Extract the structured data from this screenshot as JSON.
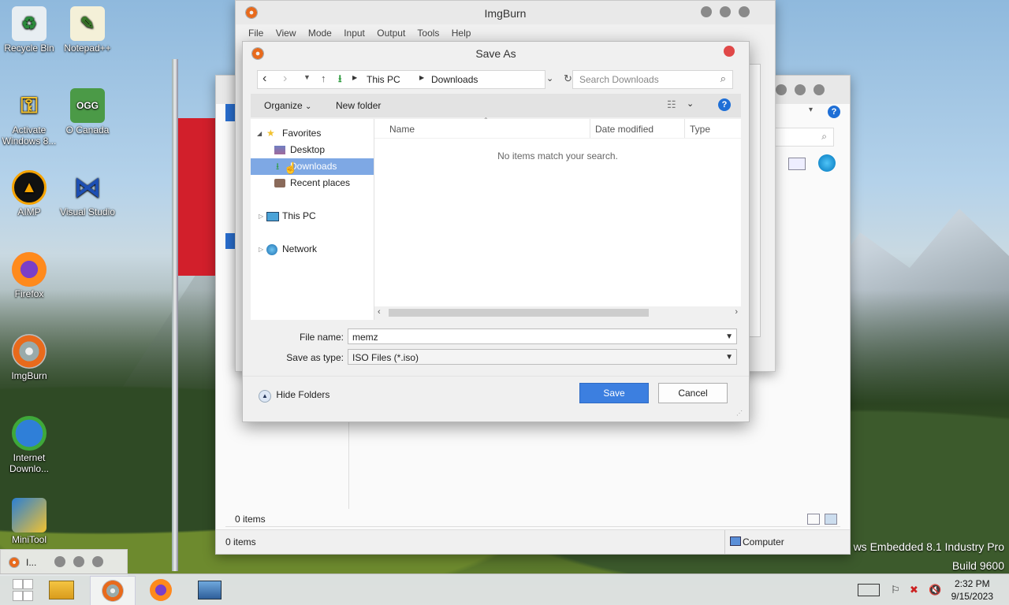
{
  "desktop": {
    "icons": [
      {
        "label": "Recycle Bin",
        "icon": "recycle-bin-icon"
      },
      {
        "label": "Notepad++",
        "icon": "notepad-plus-icon"
      },
      {
        "label": "Activate Windows 8...",
        "icon": "activate-windows-icon"
      },
      {
        "label": "O Canada",
        "icon": "ogg-file-icon",
        "glyph": "OGG"
      },
      {
        "label": "AIMP",
        "icon": "aimp-icon"
      },
      {
        "label": "Visual Studio",
        "icon": "visual-studio-icon"
      },
      {
        "label": "Firefox",
        "icon": "firefox-icon"
      },
      {
        "label": "ImgBurn",
        "icon": "imgburn-icon"
      },
      {
        "label": "Internet Downlo...",
        "icon": "internet-download-manager-icon"
      },
      {
        "label": "MiniTool",
        "icon": "minitool-icon"
      }
    ],
    "watermark_line1": "ws Embedded 8.1 Industry Pro",
    "watermark_line2": "Build 9600"
  },
  "background_window": {
    "status_left": "0 items",
    "status_inner": "0 items",
    "status_right": "Computer"
  },
  "minimized_window": {
    "label": "I..."
  },
  "imgburn": {
    "title": "ImgBurn",
    "menu": [
      "File",
      "View",
      "Mode",
      "Input",
      "Output",
      "Tools",
      "Help"
    ]
  },
  "dialog": {
    "title": "Save As",
    "breadcrumb": [
      "This PC",
      "Downloads"
    ],
    "search_placeholder": "Search Downloads",
    "organize_label": "Organize",
    "new_folder_label": "New folder",
    "nav": {
      "favorites": "Favorites",
      "desktop": "Desktop",
      "downloads": "Downloads",
      "recent": "Recent places",
      "this_pc": "This PC",
      "network": "Network"
    },
    "columns": [
      "Name",
      "Date modified",
      "Type"
    ],
    "empty_message": "No items match your search.",
    "file_name_label": "File name:",
    "file_name_value": "memz",
    "save_type_label": "Save as type:",
    "save_type_value": "ISO Files (*.iso)",
    "hide_folders_label": "Hide Folders",
    "save_label": "Save",
    "cancel_label": "Cancel"
  },
  "taskbar": {
    "time": "2:32 PM",
    "date": "9/15/2023"
  },
  "colors": {
    "accent": "#3c7fe0",
    "selection": "#7ea8e4",
    "close_red": "#e04848"
  }
}
